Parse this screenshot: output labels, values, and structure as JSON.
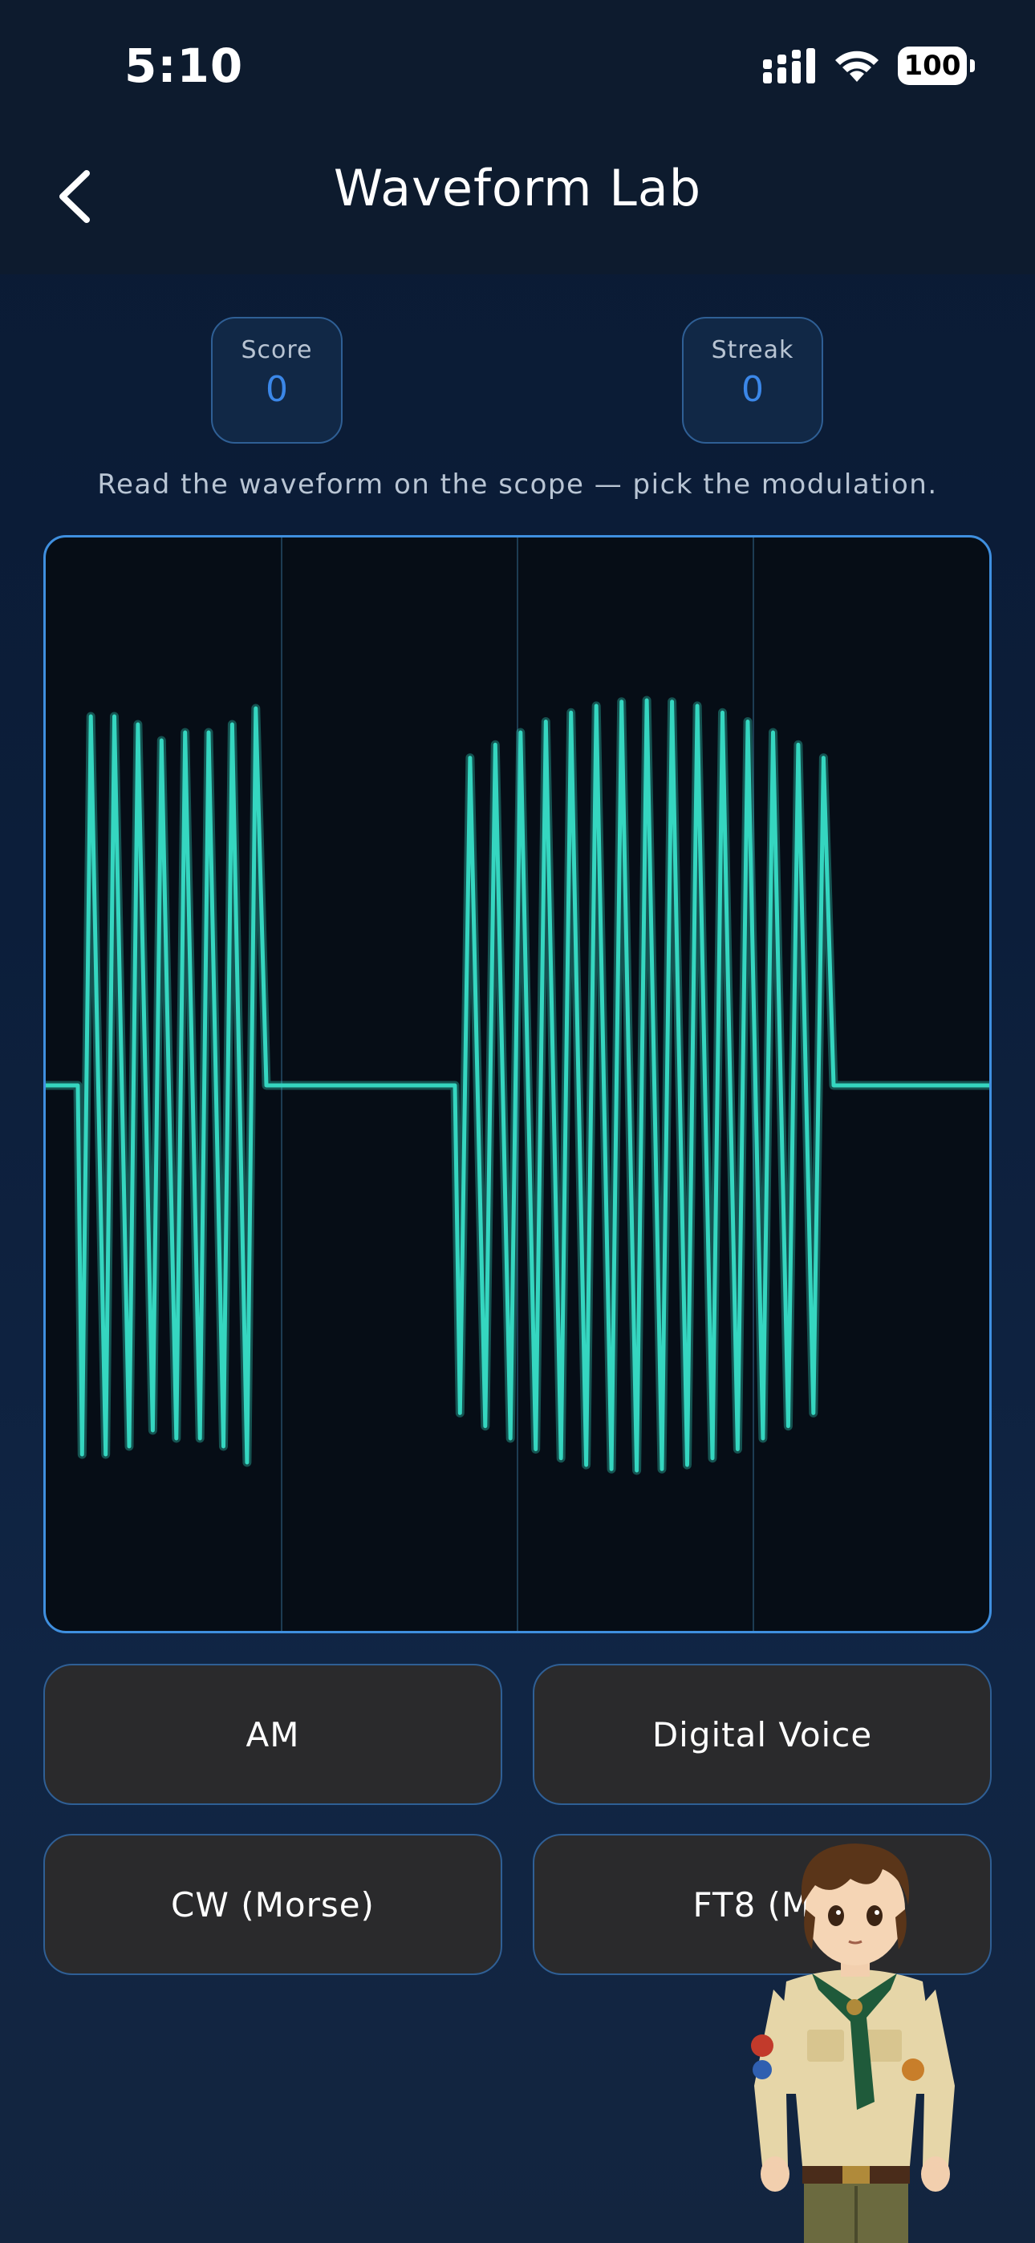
{
  "status_bar": {
    "time": "5:10",
    "battery": "100"
  },
  "nav": {
    "title": "Waveform Lab",
    "back_icon": "chevron-left-icon"
  },
  "stats": {
    "score_label": "Score",
    "score_value": "0",
    "streak_label": "Streak",
    "streak_value": "0"
  },
  "instruction": "Read the waveform on the scope — pick the modulation.",
  "scope": {
    "trace_color": "#35d6c0",
    "grid_color": "#1d3c52",
    "border_color": "#3f8fdf"
  },
  "answers": [
    {
      "label": "AM"
    },
    {
      "label": "Digital Voice"
    },
    {
      "label": "CW (Morse)"
    },
    {
      "label": "FT8 (MF"
    }
  ],
  "mascot": {
    "description_icon": "scout-character"
  }
}
